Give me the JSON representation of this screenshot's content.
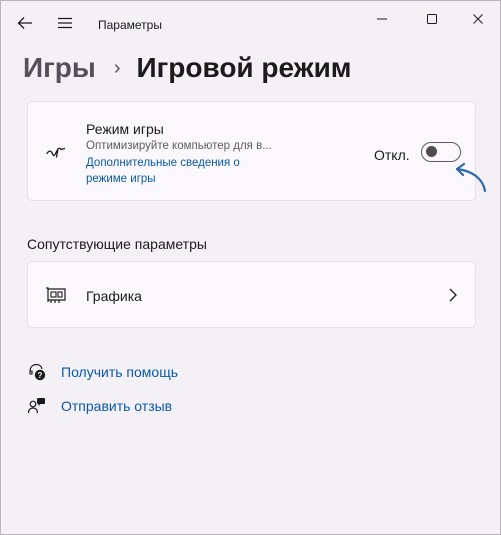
{
  "window": {
    "title": "Параметры"
  },
  "breadcrumb": {
    "parent": "Игры",
    "separator": "›",
    "current": "Игровой режим"
  },
  "game_mode": {
    "title": "Режим игры",
    "description": "Оптимизируйте компьютер для в...",
    "link": "Дополнительные сведения о режиме игры",
    "toggle_label": "Откл.",
    "toggle_on": false
  },
  "related": {
    "heading": "Сопутствующие параметры",
    "items": [
      {
        "label": "Графика",
        "icon": "graphics-card-icon"
      }
    ]
  },
  "links": {
    "help": "Получить помощь",
    "feedback": "Отправить отзыв"
  },
  "colors": {
    "accent_link": "#0a5aa8",
    "annotation_arrow": "#2e6aa8"
  }
}
